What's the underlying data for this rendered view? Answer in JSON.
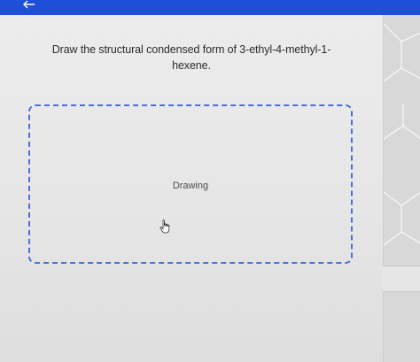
{
  "colors": {
    "top_bar": "#1e4fd8",
    "drawing_border": "#4a6fd6",
    "card_background": "#ececec"
  },
  "header": {
    "back_icon": "arrow-left-icon"
  },
  "question": {
    "text": "Draw the structural condensed form of 3-ethyl-4-methyl-1-\nhexene."
  },
  "drawing_area": {
    "label": "Drawing"
  },
  "cursor": {
    "icon": "hand-pointer-icon"
  }
}
